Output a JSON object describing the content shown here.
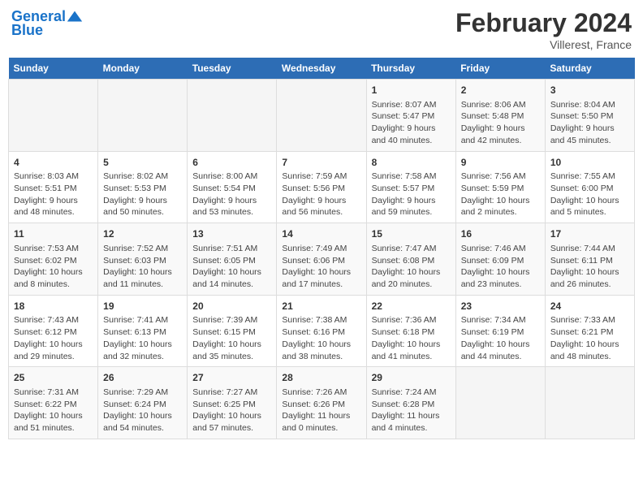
{
  "header": {
    "logo_line1": "General",
    "logo_line2": "Blue",
    "title": "February 2024",
    "subtitle": "Villerest, France"
  },
  "days_of_week": [
    "Sunday",
    "Monday",
    "Tuesday",
    "Wednesday",
    "Thursday",
    "Friday",
    "Saturday"
  ],
  "weeks": [
    [
      {
        "day": "",
        "info": ""
      },
      {
        "day": "",
        "info": ""
      },
      {
        "day": "",
        "info": ""
      },
      {
        "day": "",
        "info": ""
      },
      {
        "day": "1",
        "info": "Sunrise: 8:07 AM\nSunset: 5:47 PM\nDaylight: 9 hours\nand 40 minutes."
      },
      {
        "day": "2",
        "info": "Sunrise: 8:06 AM\nSunset: 5:48 PM\nDaylight: 9 hours\nand 42 minutes."
      },
      {
        "day": "3",
        "info": "Sunrise: 8:04 AM\nSunset: 5:50 PM\nDaylight: 9 hours\nand 45 minutes."
      }
    ],
    [
      {
        "day": "4",
        "info": "Sunrise: 8:03 AM\nSunset: 5:51 PM\nDaylight: 9 hours\nand 48 minutes."
      },
      {
        "day": "5",
        "info": "Sunrise: 8:02 AM\nSunset: 5:53 PM\nDaylight: 9 hours\nand 50 minutes."
      },
      {
        "day": "6",
        "info": "Sunrise: 8:00 AM\nSunset: 5:54 PM\nDaylight: 9 hours\nand 53 minutes."
      },
      {
        "day": "7",
        "info": "Sunrise: 7:59 AM\nSunset: 5:56 PM\nDaylight: 9 hours\nand 56 minutes."
      },
      {
        "day": "8",
        "info": "Sunrise: 7:58 AM\nSunset: 5:57 PM\nDaylight: 9 hours\nand 59 minutes."
      },
      {
        "day": "9",
        "info": "Sunrise: 7:56 AM\nSunset: 5:59 PM\nDaylight: 10 hours\nand 2 minutes."
      },
      {
        "day": "10",
        "info": "Sunrise: 7:55 AM\nSunset: 6:00 PM\nDaylight: 10 hours\nand 5 minutes."
      }
    ],
    [
      {
        "day": "11",
        "info": "Sunrise: 7:53 AM\nSunset: 6:02 PM\nDaylight: 10 hours\nand 8 minutes."
      },
      {
        "day": "12",
        "info": "Sunrise: 7:52 AM\nSunset: 6:03 PM\nDaylight: 10 hours\nand 11 minutes."
      },
      {
        "day": "13",
        "info": "Sunrise: 7:51 AM\nSunset: 6:05 PM\nDaylight: 10 hours\nand 14 minutes."
      },
      {
        "day": "14",
        "info": "Sunrise: 7:49 AM\nSunset: 6:06 PM\nDaylight: 10 hours\nand 17 minutes."
      },
      {
        "day": "15",
        "info": "Sunrise: 7:47 AM\nSunset: 6:08 PM\nDaylight: 10 hours\nand 20 minutes."
      },
      {
        "day": "16",
        "info": "Sunrise: 7:46 AM\nSunset: 6:09 PM\nDaylight: 10 hours\nand 23 minutes."
      },
      {
        "day": "17",
        "info": "Sunrise: 7:44 AM\nSunset: 6:11 PM\nDaylight: 10 hours\nand 26 minutes."
      }
    ],
    [
      {
        "day": "18",
        "info": "Sunrise: 7:43 AM\nSunset: 6:12 PM\nDaylight: 10 hours\nand 29 minutes."
      },
      {
        "day": "19",
        "info": "Sunrise: 7:41 AM\nSunset: 6:13 PM\nDaylight: 10 hours\nand 32 minutes."
      },
      {
        "day": "20",
        "info": "Sunrise: 7:39 AM\nSunset: 6:15 PM\nDaylight: 10 hours\nand 35 minutes."
      },
      {
        "day": "21",
        "info": "Sunrise: 7:38 AM\nSunset: 6:16 PM\nDaylight: 10 hours\nand 38 minutes."
      },
      {
        "day": "22",
        "info": "Sunrise: 7:36 AM\nSunset: 6:18 PM\nDaylight: 10 hours\nand 41 minutes."
      },
      {
        "day": "23",
        "info": "Sunrise: 7:34 AM\nSunset: 6:19 PM\nDaylight: 10 hours\nand 44 minutes."
      },
      {
        "day": "24",
        "info": "Sunrise: 7:33 AM\nSunset: 6:21 PM\nDaylight: 10 hours\nand 48 minutes."
      }
    ],
    [
      {
        "day": "25",
        "info": "Sunrise: 7:31 AM\nSunset: 6:22 PM\nDaylight: 10 hours\nand 51 minutes."
      },
      {
        "day": "26",
        "info": "Sunrise: 7:29 AM\nSunset: 6:24 PM\nDaylight: 10 hours\nand 54 minutes."
      },
      {
        "day": "27",
        "info": "Sunrise: 7:27 AM\nSunset: 6:25 PM\nDaylight: 10 hours\nand 57 minutes."
      },
      {
        "day": "28",
        "info": "Sunrise: 7:26 AM\nSunset: 6:26 PM\nDaylight: 11 hours\nand 0 minutes."
      },
      {
        "day": "29",
        "info": "Sunrise: 7:24 AM\nSunset: 6:28 PM\nDaylight: 11 hours\nand 4 minutes."
      },
      {
        "day": "",
        "info": ""
      },
      {
        "day": "",
        "info": ""
      }
    ]
  ]
}
